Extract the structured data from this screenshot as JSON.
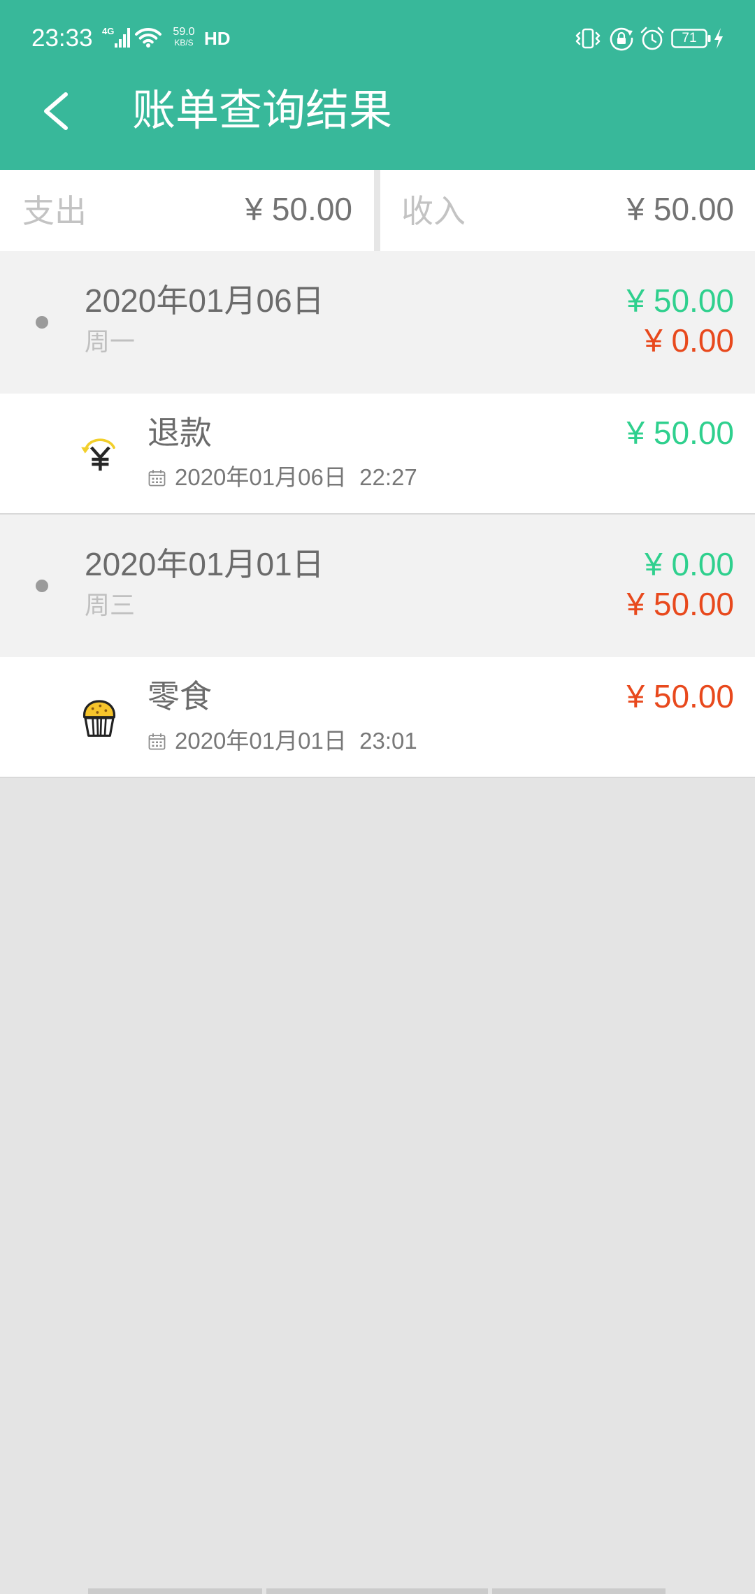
{
  "status_bar": {
    "time": "23:33",
    "network_type": "4G",
    "speed_value": "59.0",
    "speed_unit": "KB/S",
    "hd_label": "HD",
    "battery_level": "71",
    "icons": {
      "signal": "signal-icon",
      "wifi": "wifi-icon",
      "vibrate": "vibrate-icon",
      "rotation_lock": "rotation-lock-icon",
      "alarm": "alarm-icon",
      "battery": "battery-icon",
      "charging": "charging-icon"
    }
  },
  "app_bar": {
    "back_icon": "chevron-left-icon",
    "title": "账单查询结果"
  },
  "summary": {
    "expense_label": "支出",
    "expense_amount": "¥ 50.00",
    "income_label": "收入",
    "income_amount": "¥ 50.00"
  },
  "days": [
    {
      "date": "2020年01月06日",
      "weekday": "周一",
      "income_total": "¥ 50.00",
      "expense_total": "¥ 0.00",
      "entries": [
        {
          "icon": "refund-icon",
          "category": "退款",
          "datetime_icon": "calendar-icon",
          "datetime": "2020年01月06日  22:27",
          "amount": "¥ 50.00",
          "amount_color": "#2fd08e"
        }
      ]
    },
    {
      "date": "2020年01月01日",
      "weekday": "周三",
      "income_total": "¥ 0.00",
      "expense_total": "¥ 50.00",
      "entries": [
        {
          "icon": "muffin-icon",
          "category": "零食",
          "datetime_icon": "calendar-icon",
          "datetime": "2020年01月01日  23:01",
          "amount": "¥ 50.00",
          "amount_color": "#e8491d"
        }
      ]
    }
  ],
  "colors": {
    "primary": "#38b89a",
    "income": "#2fd08e",
    "expense": "#e8491d",
    "day_background": "#f2f2f2",
    "page_background": "#e4e4e4"
  }
}
